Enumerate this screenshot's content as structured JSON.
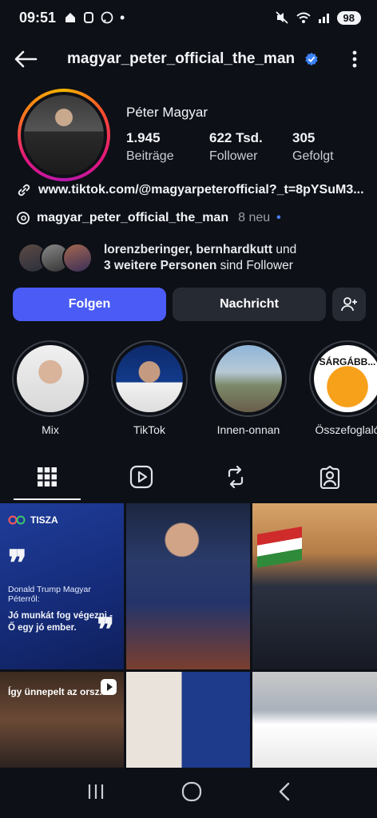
{
  "status": {
    "time": "09:51",
    "battery": "98"
  },
  "header": {
    "username": "magyar_peter_official_the_man"
  },
  "profile": {
    "display_name": "Péter Magyar",
    "stats": [
      {
        "num": "1.945",
        "label": "Beiträge"
      },
      {
        "num": "622 Tsd.",
        "label": "Follower"
      },
      {
        "num": "305",
        "label": "Gefolgt"
      }
    ],
    "link": "www.tiktok.com/@magyarpeterofficial?_t=8pYSuM3...",
    "threads_handle": "magyar_peter_official_the_man",
    "threads_new": "8 neu",
    "followers_line1_names": "lorenzberinger, bernhardkutt",
    "followers_line1_tail": " und",
    "followers_line2_bold": "3 weitere Personen",
    "followers_line2_tail": " sind Follower"
  },
  "buttons": {
    "follow": "Folgen",
    "message": "Nachricht"
  },
  "highlights": [
    {
      "label": "Mix"
    },
    {
      "label": "TikTok"
    },
    {
      "label": "Innen-onnan"
    },
    {
      "label": "Összefoglaló",
      "badge": "SÁRGÁBB..."
    }
  ],
  "posts": {
    "p1": {
      "brand": "TISZA",
      "byline": "Donald Trump Magyar Péterről:",
      "quote": "Jó munkát fog végezni - Ő egy jó ember."
    },
    "p4": {
      "caption": "Így ünnepelt az orsz..."
    }
  },
  "colors": {
    "accent": "#4a5cf5",
    "verified": "#3b82f6",
    "background": "#0d1016"
  }
}
